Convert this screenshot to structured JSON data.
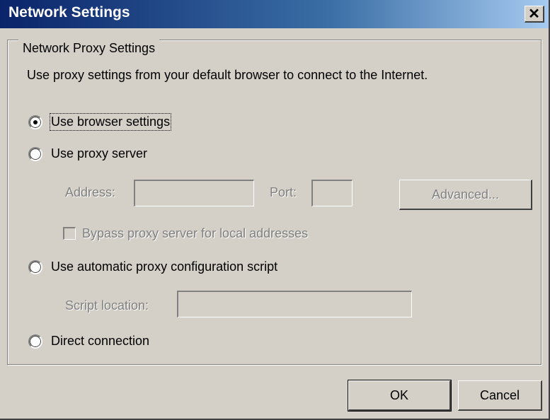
{
  "window": {
    "title": "Network Settings",
    "close_glyph": "✕",
    "close_icon": "close-icon"
  },
  "group": {
    "legend": "Network Proxy Settings"
  },
  "description": "Use proxy settings from your default browser to connect to the Internet.",
  "options": {
    "browser": "Use browser settings",
    "proxy": "Use proxy server",
    "auto": "Use automatic proxy configuration script",
    "direct": "Direct connection"
  },
  "selected_option": "browser",
  "proxy": {
    "address_label": "Address:",
    "address_value": "",
    "port_label": "Port:",
    "port_value": "",
    "advanced_label": "Advanced...",
    "bypass_label": "Bypass proxy server for local addresses",
    "bypass_checked": false
  },
  "auto": {
    "script_label": "Script location:",
    "script_value": ""
  },
  "buttons": {
    "ok": "OK",
    "cancel": "Cancel"
  }
}
